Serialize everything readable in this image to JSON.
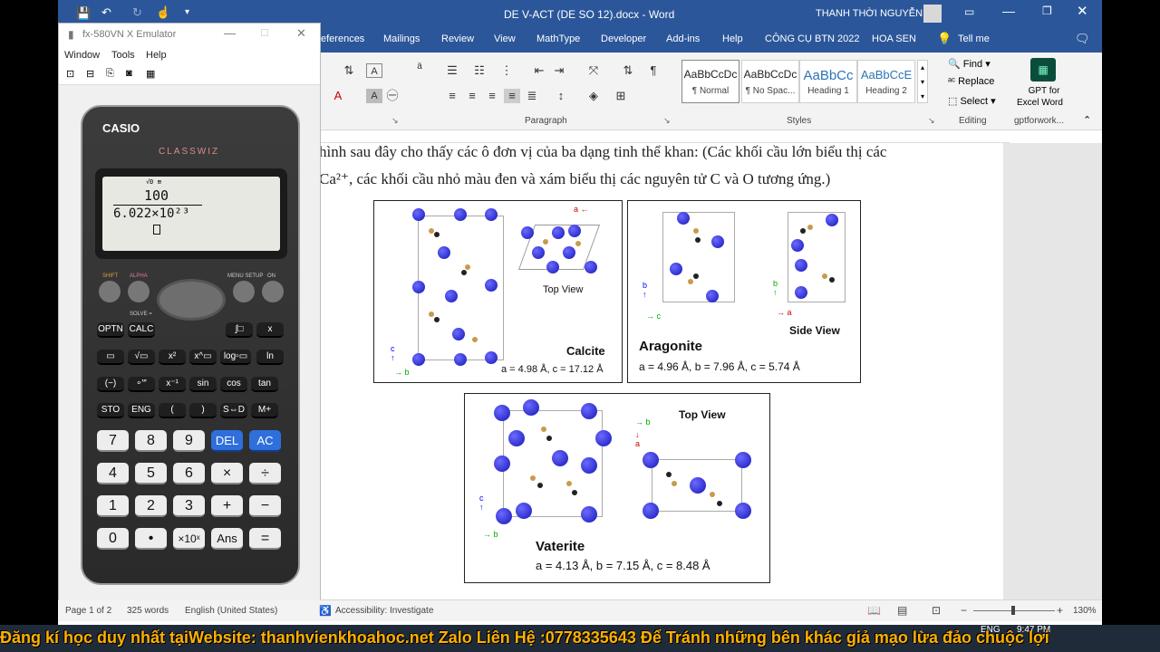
{
  "word": {
    "title": "DE V-ACT (DE SO 12).docx  -  Word",
    "user": "THANH THỜI NGUYỄN",
    "tabs": [
      "eferences",
      "Mailings",
      "Review",
      "View",
      "MathType",
      "Developer",
      "Add-ins",
      "Help",
      "CÔNG CỤ BTN 2022",
      "HOA SEN",
      "Tell me"
    ],
    "groups": {
      "paragraph": "Paragraph",
      "styles": "Styles",
      "editing": "Editing",
      "gptforwork": "gptforwork..."
    },
    "styles": [
      {
        "sample": "AaBbCcDc",
        "name": "¶ Normal"
      },
      {
        "sample": "AaBbCcDc",
        "name": "¶ No Spac..."
      },
      {
        "sample": "AaBbCc",
        "name": "Heading 1"
      },
      {
        "sample": "AaBbCcE",
        "name": "Heading 2"
      }
    ],
    "editing": {
      "find": "Find",
      "replace": "Replace",
      "select": "Select"
    },
    "gpt": {
      "line1": "GPT for",
      "line2": "Excel Word"
    },
    "status": {
      "page": "Page 1 of 2",
      "words": "325 words",
      "language": "English (United States)",
      "accessibility": "Accessibility: Investigate",
      "zoom": "130%"
    },
    "doc": {
      "line1": "hình sau đây cho thấy các ô đơn vị của ba dạng tinh thể khan: (Các khối cầu lớn biểu thị các",
      "line2": "Ca²⁺, các khối cầu nhỏ màu đen và xám biểu thị các nguyên tử C và O tương ứng.)",
      "figures": {
        "calcite": {
          "name": "Calcite",
          "params": "a = 4.98 Å, c = 17.12 Å",
          "top_view": "Top View"
        },
        "aragonite": {
          "name": "Aragonite",
          "params": "a = 4.96 Å, b = 7.96 Å, c = 5.74 Å",
          "side_view": "Side View"
        },
        "vaterite": {
          "name": "Vaterite",
          "params": "a = 4.13 Å, b = 7.15 Å, c = 8.48 Å",
          "top_view": "Top View"
        }
      }
    }
  },
  "emulator": {
    "title": "fx-580VN X Emulator",
    "menu": [
      "Window",
      "Tools",
      "Help"
    ],
    "brand": "CASIO",
    "model": "CLASSWIZ",
    "display": {
      "numerator": "100",
      "denominator": "6.022×10²³"
    },
    "keys": {
      "row_fn": [
        "OPTN",
        "CALC",
        "∫□",
        "x"
      ],
      "row2": [
        "▭",
        "√▭",
        "x²",
        "x^▭",
        "log▫▭",
        "ln"
      ],
      "row3": [
        "(−)",
        "∘′″",
        "x⁻¹",
        "sin",
        "cos",
        "tan"
      ],
      "row4": [
        "STO",
        "ENG",
        "(",
        ")",
        "S⇔D",
        "M+"
      ],
      "digits": [
        [
          "7",
          "8",
          "9",
          "DEL",
          "AC"
        ],
        [
          "4",
          "5",
          "6",
          "×",
          "÷"
        ],
        [
          "1",
          "2",
          "3",
          "+",
          "−"
        ],
        [
          "0",
          "•",
          "×10ˣ",
          "Ans",
          "="
        ]
      ]
    }
  },
  "banner": "Đăng kí học duy nhất tạiWebsite: thanhvienkhoahoc.net  Zalo Liên Hệ :0778335643 Để Tránh những bên khác giả mạo lừa đảo chuộc lợi",
  "taskbar": {
    "lang": "ENG",
    "time": "9:47 PM"
  }
}
